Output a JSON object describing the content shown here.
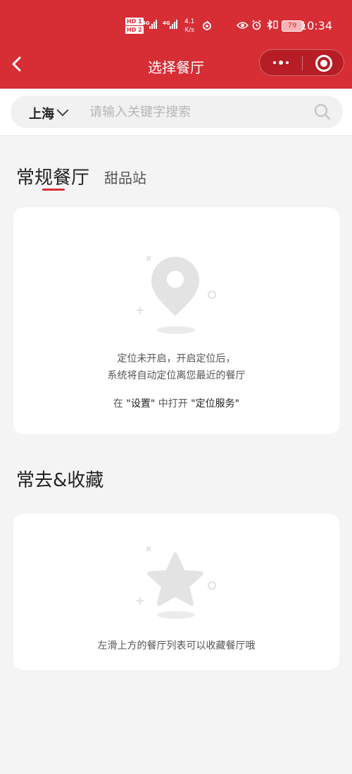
{
  "status_bar": {
    "hd_top": "HD 1",
    "hd_bottom": "HD 2",
    "net1": "4G",
    "net2": "4G",
    "speed_value": "4.1",
    "speed_unit": "K/s",
    "battery": "79",
    "time": "10:34"
  },
  "navbar": {
    "title": "选择餐厅",
    "back_icon": "chevron-left-icon",
    "more_icon": "more-dots-icon",
    "close_icon": "target-close-icon"
  },
  "search": {
    "city": "上海",
    "placeholder": "请输入关键字搜索",
    "icon": "search-icon"
  },
  "tabs": [
    {
      "label": "常规餐厅",
      "active": true
    },
    {
      "label": "甜品站",
      "active": false
    }
  ],
  "location_card": {
    "icon": "location-pin-icon",
    "line1": "定位未开启，开启定位后，",
    "line2": "系统将自动定位离您最近的餐厅",
    "hint_prefix": "在",
    "hint_settings": "\"设置\"",
    "hint_middle": "中打开",
    "hint_service": "\"定位服务\""
  },
  "favorites": {
    "title": "常去&收藏",
    "icon": "star-icon",
    "empty_text": "左滑上方的餐厅列表可以收藏餐厅哦"
  },
  "colors": {
    "brand_red": "#d72d35",
    "page_bg": "#f4f4f4",
    "illustration_gray": "#e4e4e4"
  }
}
